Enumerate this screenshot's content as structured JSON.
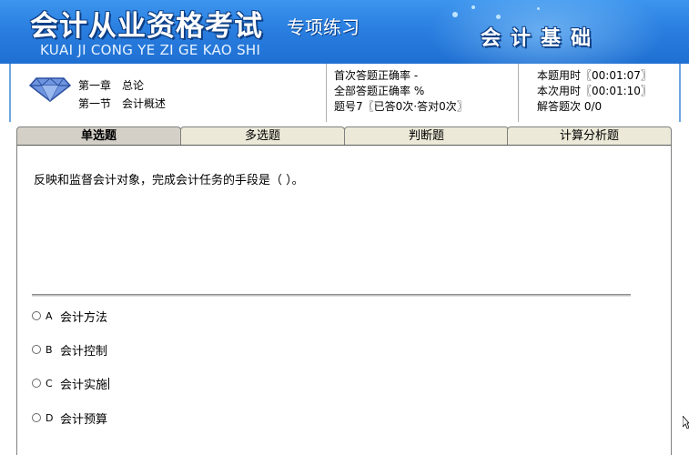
{
  "banner": {
    "title": "会计从业资格考试",
    "subtitle": "专项练习",
    "pinyin": "KUAI JI CONG YE ZI GE KAO SHI",
    "subject": "会计基础"
  },
  "chapter": {
    "chapter_label": "第一章",
    "chapter_name": "总论",
    "section_label": "第一节",
    "section_name": "会计概述"
  },
  "stats": {
    "first_accuracy": "首次答题正确率  -",
    "overall_accuracy": "全部答题正确率  %",
    "question_info": "题号7〖已答0次·答对0次〗"
  },
  "timers": {
    "question_time": "本题用时〖00:01:07〗",
    "session_time": "本次用时〖00:01:10〗",
    "answered_count": "解答题次 0/0"
  },
  "tabs": [
    {
      "label": "单选题",
      "active": true
    },
    {
      "label": "多选题",
      "active": false
    },
    {
      "label": "判断题",
      "active": false
    },
    {
      "label": "计算分析题",
      "active": false
    }
  ],
  "question": {
    "text": "反映和监督会计对象，完成会计任务的手段是（    ）。"
  },
  "options": [
    {
      "letter": "A",
      "text": "会计方法"
    },
    {
      "letter": "B",
      "text": "会计控制"
    },
    {
      "letter": "C",
      "text": "会计实施"
    },
    {
      "letter": "D",
      "text": "会计预算"
    }
  ],
  "colors": {
    "banner_blue": "#2a7fe0",
    "tab_active": "#d4d0c8",
    "tab_inactive": "#ece9d8"
  }
}
